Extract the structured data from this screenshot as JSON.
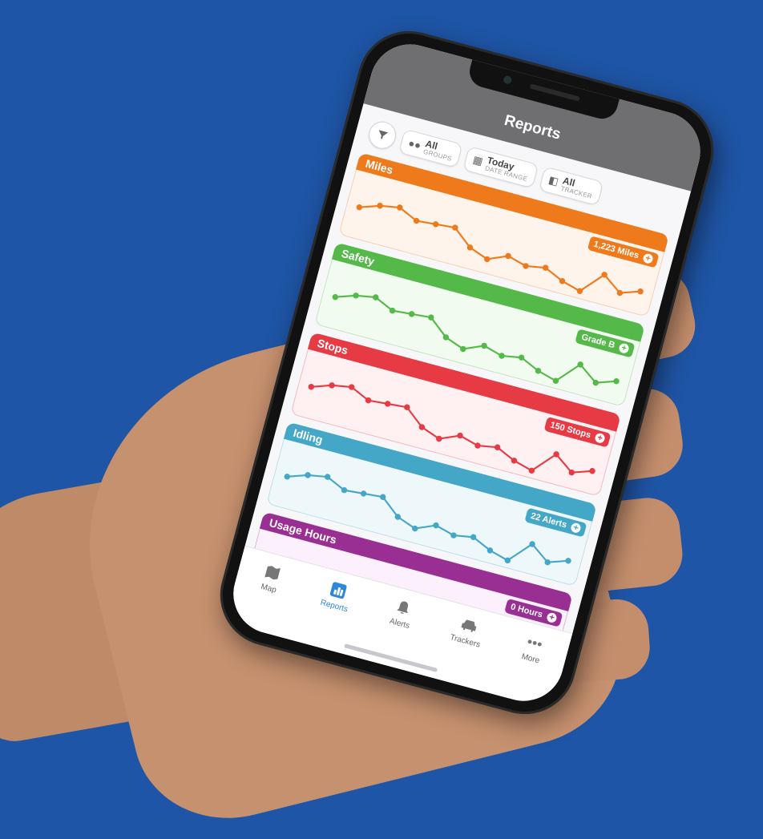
{
  "header": {
    "title": "Reports"
  },
  "filters": {
    "groups": {
      "value": "All",
      "label": "GROUPS"
    },
    "date_range": {
      "value": "Today",
      "label": "DATE RANGE"
    },
    "tracker": {
      "value": "All",
      "label": "TRACKER"
    }
  },
  "cards": [
    {
      "title": "Miles",
      "summary": "1,223 Miles",
      "color": "#ef7a1c",
      "bg": "#fff4ec"
    },
    {
      "title": "Safety",
      "summary": "Grade B",
      "color": "#54b948",
      "bg": "#f2fbef"
    },
    {
      "title": "Stops",
      "summary": "150 Stops",
      "color": "#e63b45",
      "bg": "#fff0f1"
    },
    {
      "title": "Idling",
      "summary": "22 Alerts",
      "color": "#45a7c7",
      "bg": "#eef8fb"
    },
    {
      "title": "Usage Hours",
      "summary": "0 Hours",
      "color": "#9a2f93",
      "bg": "#fbf0fb"
    }
  ],
  "tabbar": {
    "items": [
      {
        "label": "Map",
        "icon": "map-icon"
      },
      {
        "label": "Reports",
        "icon": "reports-icon",
        "active": true
      },
      {
        "label": "Alerts",
        "icon": "bell-icon"
      },
      {
        "label": "Trackers",
        "icon": "car-icon"
      },
      {
        "label": "More",
        "icon": "more-icon"
      }
    ]
  }
}
